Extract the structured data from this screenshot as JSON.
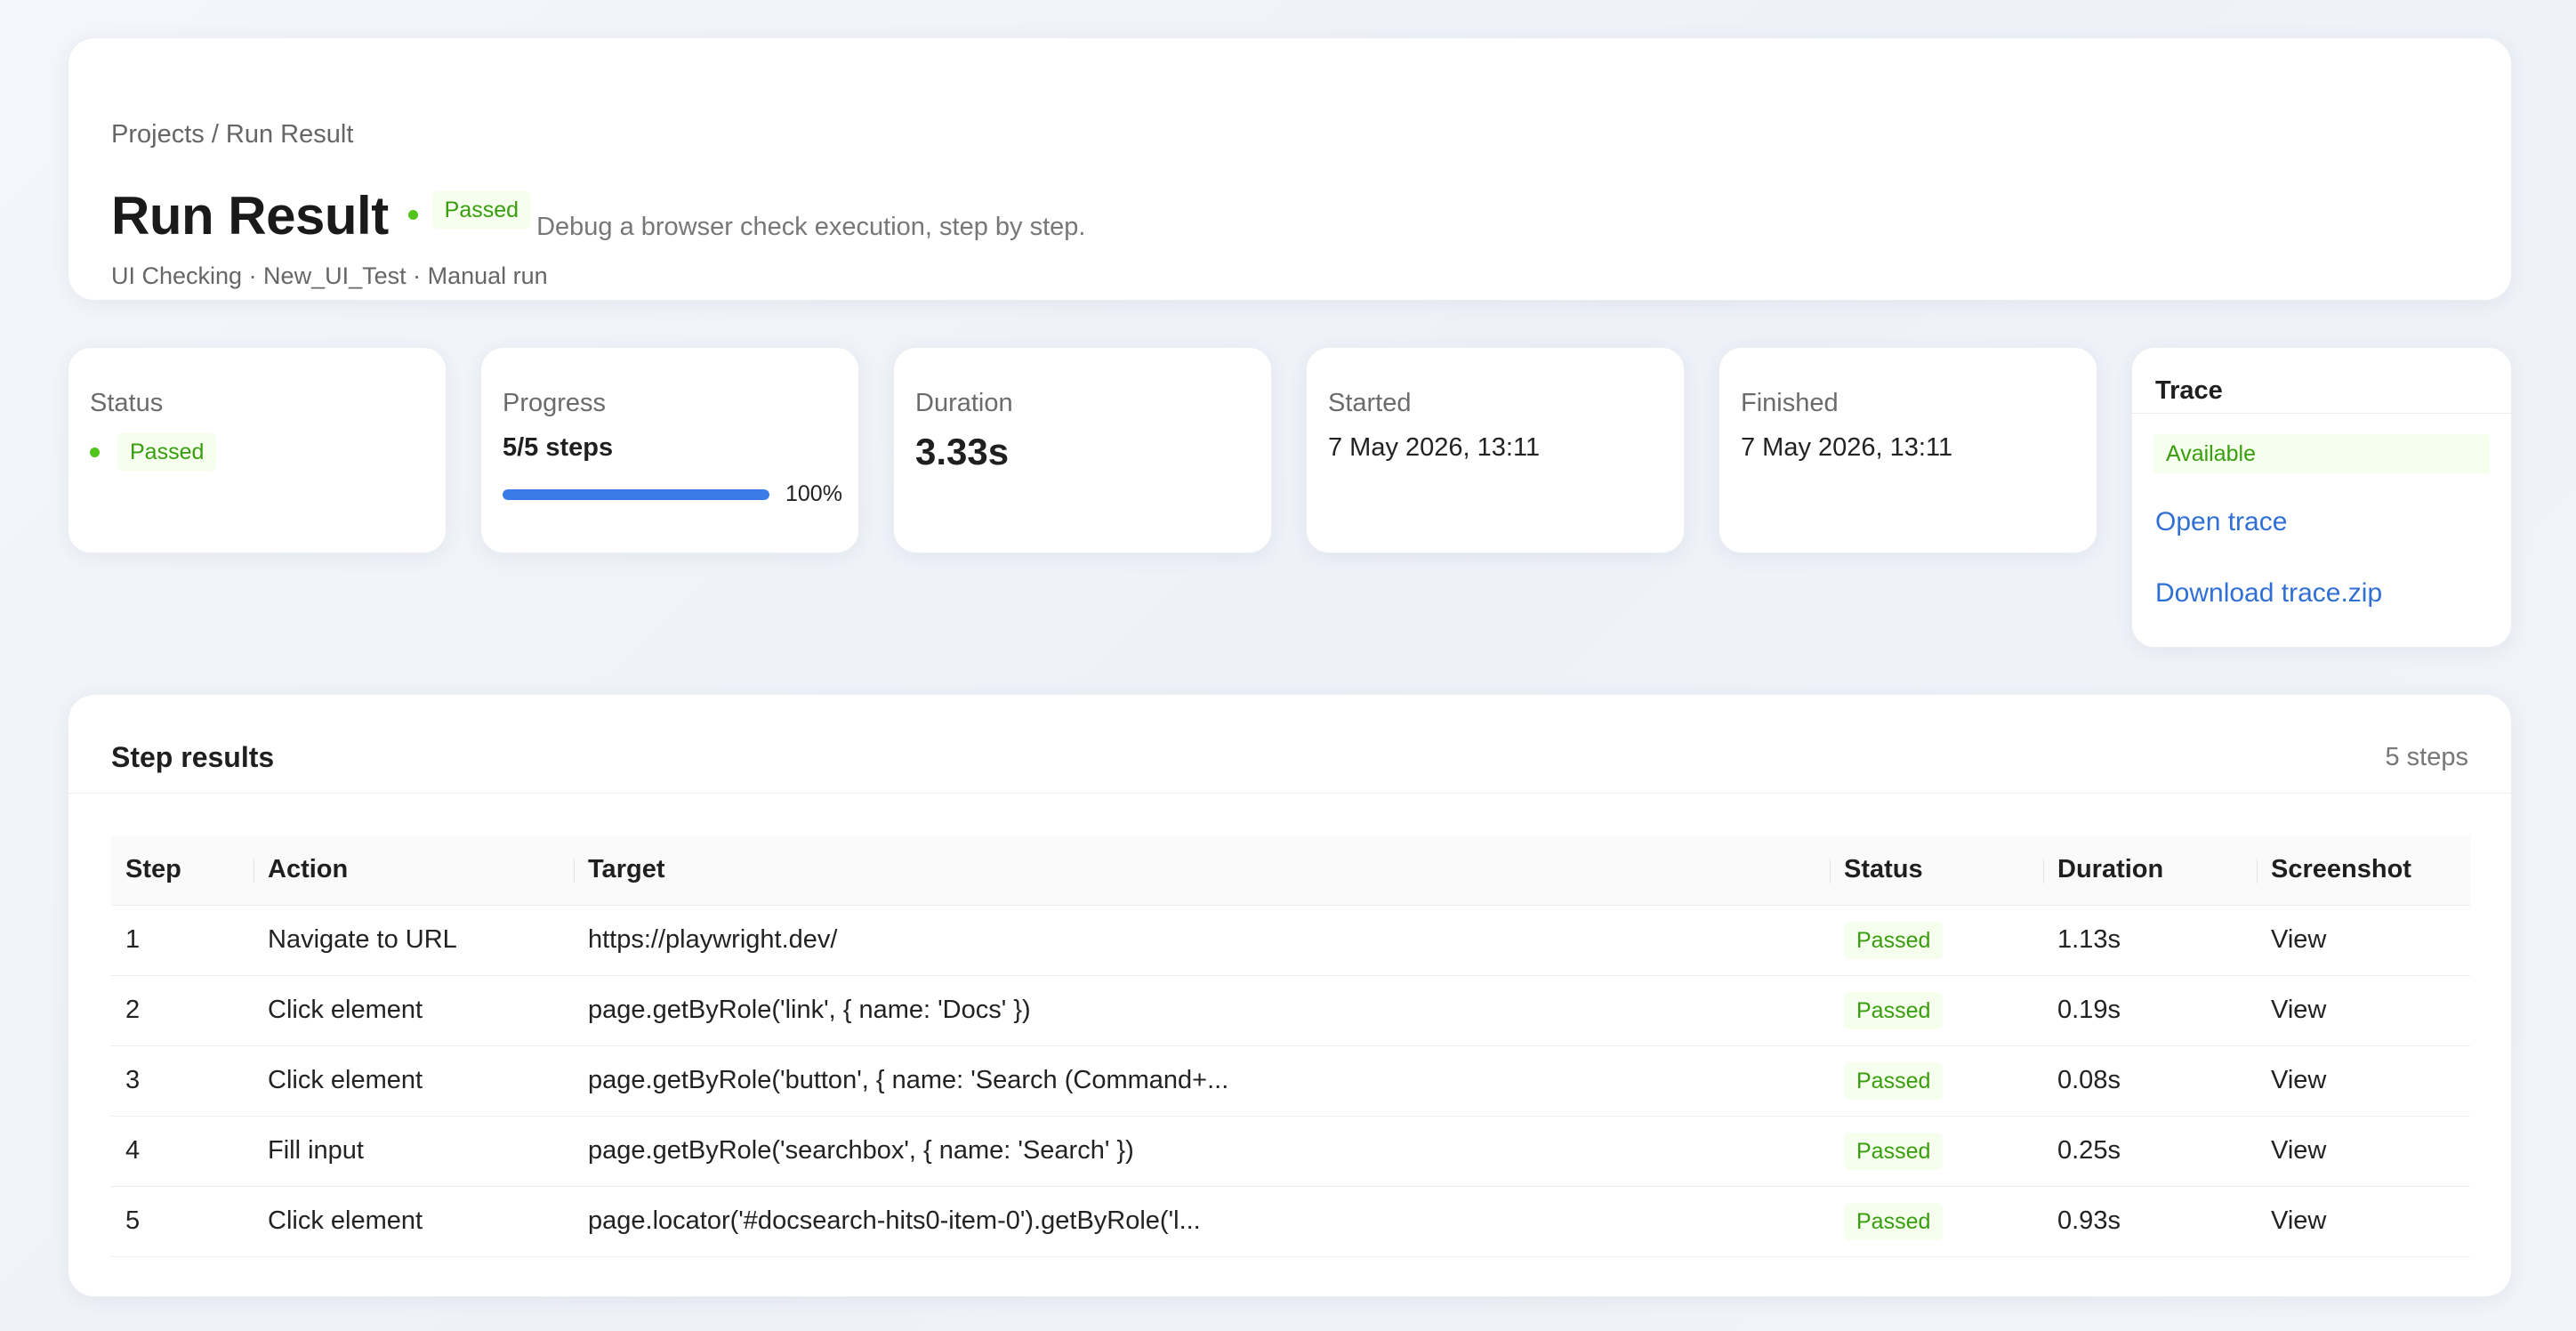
{
  "header": {
    "breadcrumb": "Projects / Run Result",
    "title": "Run Result",
    "status_badge": "Passed",
    "subtitle": "Debug a browser check execution, step by step.",
    "meta": "UI Checking · New_UI_Test · Manual run"
  },
  "stats": {
    "status": {
      "label": "Status",
      "value": "Passed"
    },
    "progress": {
      "label": "Progress",
      "value": "5/5 steps",
      "percent_text": "100%",
      "fraction": 1.0
    },
    "duration": {
      "label": "Duration",
      "value": "3.33s"
    },
    "started": {
      "label": "Started",
      "value": "7 May 2026, 13:11"
    },
    "finished": {
      "label": "Finished",
      "value": "7 May 2026, 13:11"
    }
  },
  "trace": {
    "title": "Trace",
    "status": "Available",
    "open_label": "Open trace",
    "download_label": "Download trace.zip"
  },
  "steps": {
    "title": "Step results",
    "count": "5 steps",
    "columns": [
      "Step",
      "Action",
      "Target",
      "Status",
      "Duration",
      "Screenshot"
    ],
    "rows": [
      {
        "step": "1",
        "action": "Navigate to URL",
        "target": "https://playwright.dev/",
        "status": "Passed",
        "duration": "1.13s",
        "screenshot": "View"
      },
      {
        "step": "2",
        "action": "Click element",
        "target": "page.getByRole('link', { name: 'Docs' })",
        "status": "Passed",
        "duration": "0.19s",
        "screenshot": "View"
      },
      {
        "step": "3",
        "action": "Click element",
        "target": "page.getByRole('button', { name: 'Search (Command+...",
        "status": "Passed",
        "duration": "0.08s",
        "screenshot": "View"
      },
      {
        "step": "4",
        "action": "Fill input",
        "target": "page.getByRole('searchbox', { name: 'Search' })",
        "status": "Passed",
        "duration": "0.25s",
        "screenshot": "View"
      },
      {
        "step": "5",
        "action": "Click element",
        "target": "page.locator('#docsearch-hits0-item-0').getByRole('l...",
        "status": "Passed",
        "duration": "0.93s",
        "screenshot": "View"
      }
    ]
  },
  "colors": {
    "success": "#52c41a",
    "success_text": "#389e0d",
    "success_bg": "#f6ffed",
    "link": "#2f6fd6",
    "progress": "#3a7be8"
  }
}
